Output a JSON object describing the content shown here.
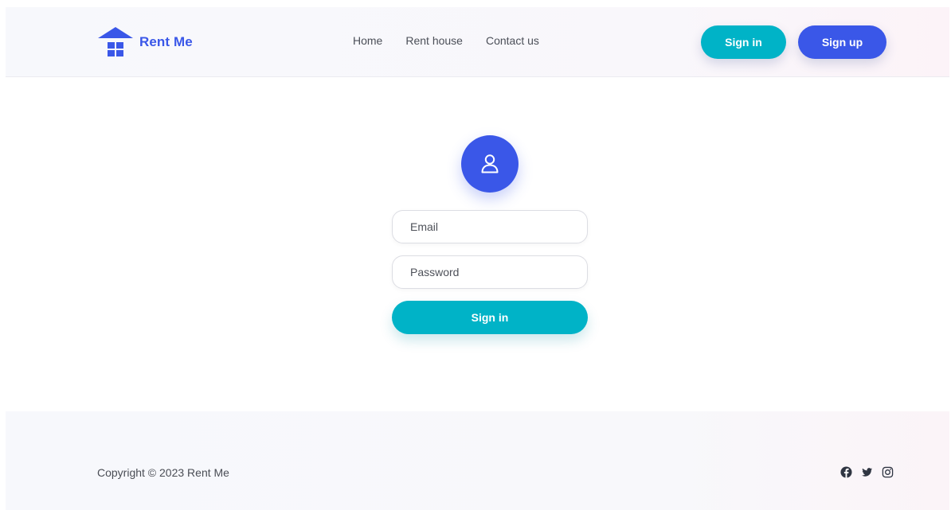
{
  "brand": {
    "name": "Rent Me",
    "color": "#3a57e8",
    "icon": "house-icon"
  },
  "nav": {
    "items": [
      {
        "label": "Home"
      },
      {
        "label": "Rent house"
      },
      {
        "label": "Contact us"
      }
    ]
  },
  "header_actions": {
    "signin_label": "Sign in",
    "signup_label": "Sign up",
    "signin_color": "#00b3c7",
    "signup_color": "#3a57e8"
  },
  "login_form": {
    "avatar_icon": "user-icon",
    "email": {
      "placeholder": "Email",
      "value": ""
    },
    "password": {
      "placeholder": "Password",
      "value": ""
    },
    "submit_label": "Sign in"
  },
  "footer": {
    "copyright": "Copyright © 2023 Rent Me",
    "social_icons": [
      "facebook-icon",
      "twitter-icon",
      "instagram-icon"
    ]
  }
}
